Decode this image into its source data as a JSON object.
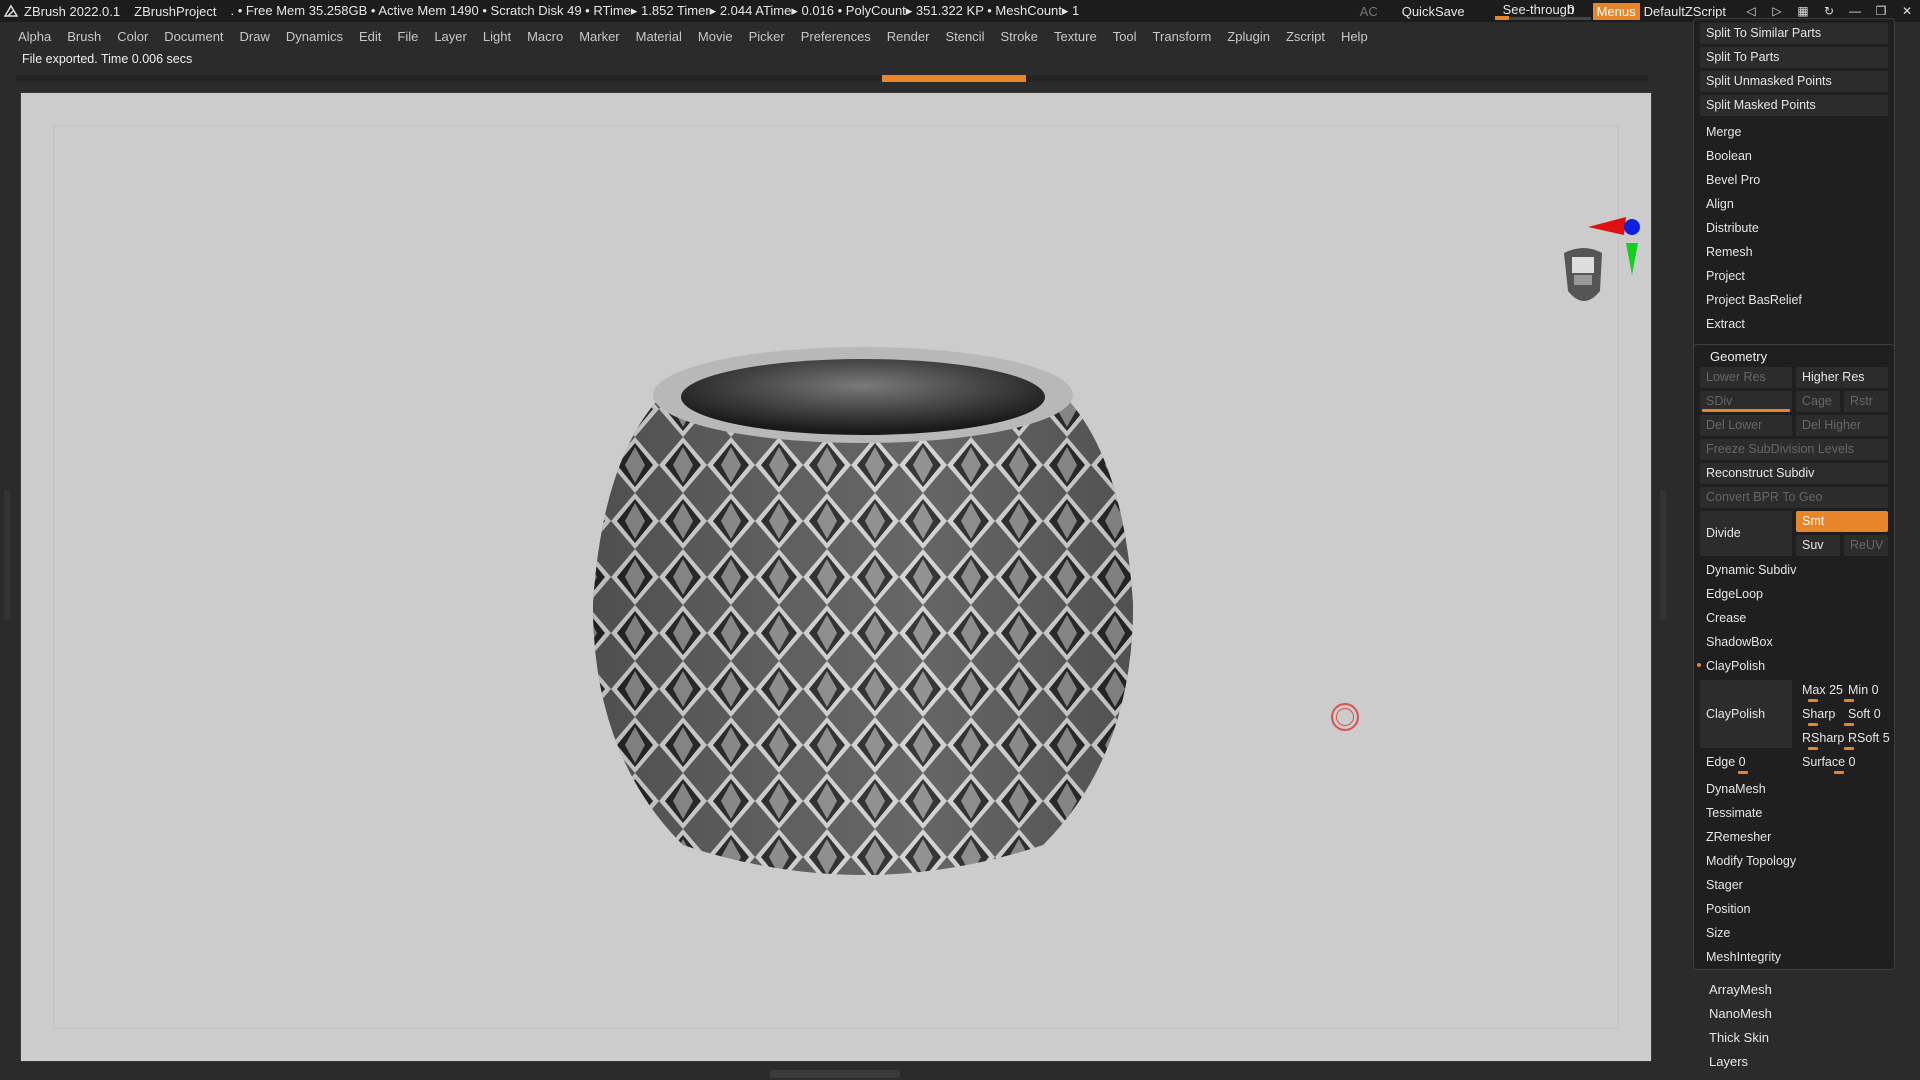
{
  "titlebar": {
    "app": "ZBrush 2022.0.1",
    "project": "ZBrushProject",
    "stats": ". • Free Mem 35.258GB • Active Mem 1490 • Scratch Disk 49 •  RTime▸ 1.852 Timer▸ 2.044 ATime▸ 0.016 • PolyCount▸ 351.322 KP  • MeshCount▸ 1",
    "ac": "AC",
    "quicksave": "QuickSave",
    "see_through_label": "See-through",
    "see_through_value": "0",
    "see_through_level": 0,
    "menus": "Menus",
    "script": "DefaultZScript"
  },
  "menubar": [
    "Alpha",
    "Brush",
    "Color",
    "Document",
    "Draw",
    "Dynamics",
    "Edit",
    "File",
    "Layer",
    "Light",
    "Macro",
    "Marker",
    "Material",
    "Movie",
    "Picker",
    "Preferences",
    "Render",
    "Stencil",
    "Stroke",
    "Texture",
    "Tool",
    "Transform",
    "Zplugin",
    "Zscript",
    "Help"
  ],
  "notification": "File exported. Time 0.006 secs",
  "panel": {
    "top_buttons": [
      "Split To Similar Parts",
      "Split To Parts",
      "Split Unmasked Points",
      "Split Masked Points"
    ],
    "subtool_items": [
      "Merge",
      "Boolean",
      "Bevel Pro",
      "Align",
      "Distribute",
      "Remesh",
      "Project",
      "Project BasRelief",
      "Extract"
    ],
    "geometry": {
      "title": "Geometry",
      "lower_res": "Lower Res",
      "higher_res": "Higher Res",
      "sdiv": "SDiv",
      "cage": "Cage",
      "rstr": "Rstr",
      "del_lower": "Del Lower",
      "del_higher": "Del Higher",
      "freeze": "Freeze SubDivision Levels",
      "reconstruct": "Reconstruct Subdiv",
      "convert_bpr": "Convert BPR To Geo",
      "divide": "Divide",
      "smt": "Smt",
      "suv": "Suv",
      "reuv": "ReUV",
      "dynamic_subdiv": "Dynamic Subdiv",
      "edgeloop": "EdgeLoop",
      "crease": "Crease",
      "shadowbox": "ShadowBox",
      "claypolish_header": "ClayPolish",
      "claypolish_btn": "ClayPolish",
      "max": "Max 25",
      "min": "Min 0",
      "sharp": "Sharp",
      "soft": "Soft 0",
      "rsharp": "RSharp",
      "rsoft": "RSoft 5",
      "edge": "Edge 0",
      "surface": "Surface 0",
      "more": [
        "DynaMesh",
        "Tessimate",
        "ZRemesher",
        "Modify Topology",
        "Stager",
        "Position",
        "Size",
        "MeshIntegrity"
      ]
    },
    "bottom_items": [
      "ArrayMesh",
      "NanoMesh",
      "Thick Skin",
      "Layers"
    ]
  }
}
